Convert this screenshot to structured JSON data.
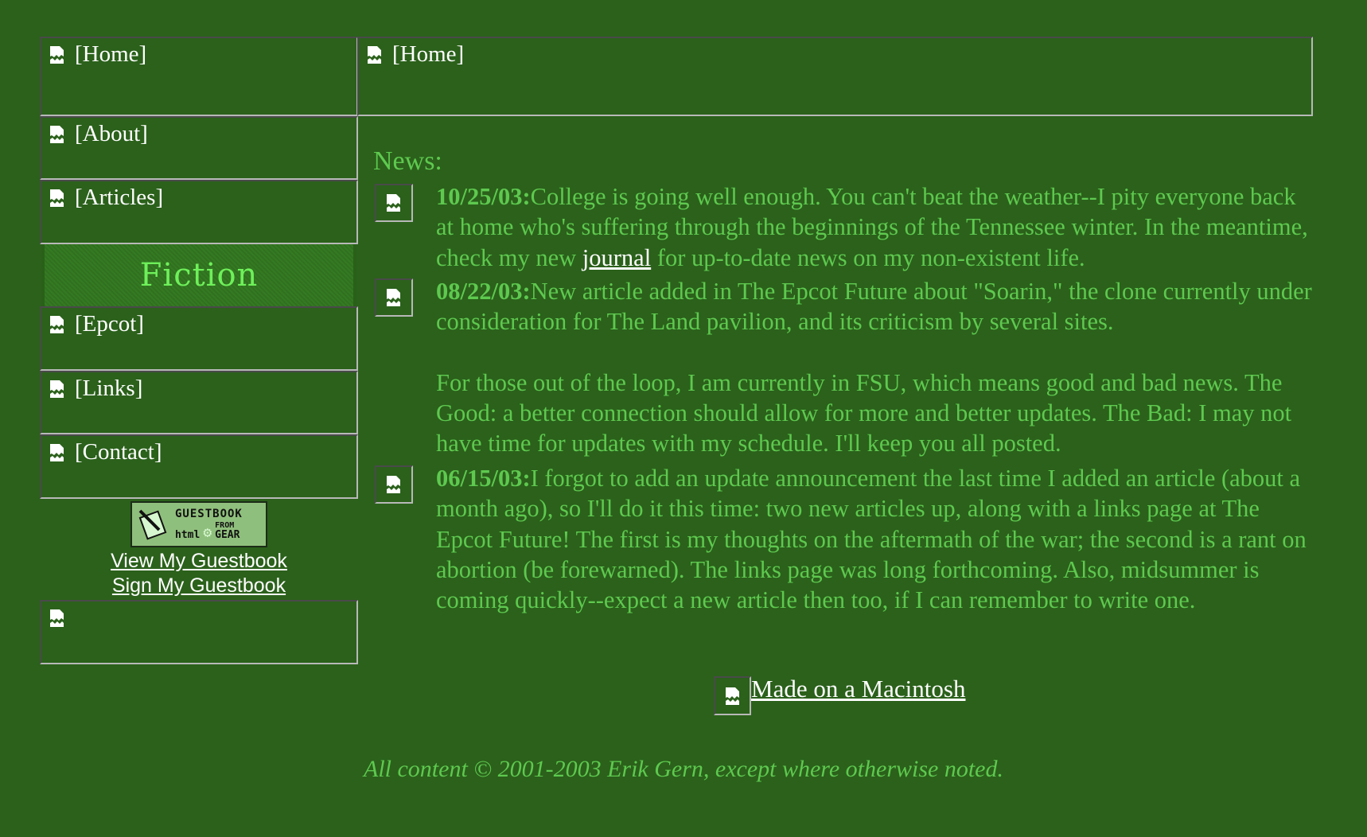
{
  "colors": {
    "background": "#2b611b",
    "text": "#5ec94f",
    "link": "#ffffff",
    "fiction_banner_text": "#6ef05a"
  },
  "sidebar": {
    "items": [
      {
        "label": "[Home]",
        "icon": "broken-image-icon"
      },
      {
        "label": "[About]",
        "icon": "broken-image-icon"
      },
      {
        "label": "[Articles]",
        "icon": "broken-image-icon"
      },
      {
        "label": "[Epcot]",
        "icon": "broken-image-icon"
      },
      {
        "label": "[Links]",
        "icon": "broken-image-icon"
      },
      {
        "label": "[Contact]",
        "icon": "broken-image-icon"
      }
    ],
    "section_banner": "Fiction",
    "guestbook": {
      "badge_line1": "GUESTBOOK",
      "badge_from": "FROM",
      "badge_html": "html",
      "badge_gear": "GEAR",
      "view_label": "View My Guestbook",
      "sign_label": "Sign My Guestbook"
    }
  },
  "header": {
    "home_label": "[Home]"
  },
  "news": {
    "title": "News:",
    "entries": [
      {
        "date": "10/25/03:",
        "text_before_link": "College is going well enough. You can't beat the weather--I pity everyone back at home who's suffering through the beginnings of the Tennessee winter. In the meantime, check my new ",
        "link": "journal",
        "text_after_link": " for up-to-date news on my non-existent life."
      },
      {
        "date": "08/22/03:",
        "text": "New article added in The Epcot Future about \"Soarin,\" the clone currently under consideration for The Land pavilion, and its criticism by several sites.",
        "text2": "For those out of the loop, I am currently in FSU, which means good and bad news. The Good: a better connection should allow for more and better updates. The Bad: I may not have time for updates with my schedule. I'll keep you all posted."
      },
      {
        "date": "06/15/03:",
        "text": "I forgot to add an update announcement the last time I added an article (about a month ago), so I'll do it this time: two new articles up, along with a links page at The Epcot Future! The first is my thoughts on the aftermath of the war; the second is a rant on abortion (be forewarned). The links page was long forthcoming. Also, midsummer is coming quickly--expect a new article then too, if I can remember to write one."
      }
    ]
  },
  "mac_badge": {
    "label": "Made on a Macintosh"
  },
  "footer": {
    "copyright": "All content © 2001-2003 Erik Gern, except where otherwise noted."
  }
}
